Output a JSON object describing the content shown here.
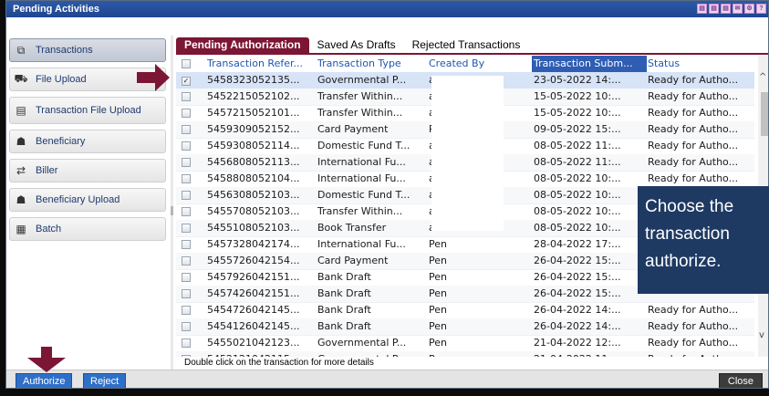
{
  "window": {
    "title": "Pending Activities"
  },
  "sidebar": {
    "items": [
      {
        "label": "Transactions",
        "icon": "transactions-icon",
        "glyph": "⧉"
      },
      {
        "label": "File Upload",
        "icon": "truck-icon",
        "glyph": "⛟"
      },
      {
        "label": "Transaction File Upload",
        "icon": "file-icon",
        "glyph": "▤"
      },
      {
        "label": "Beneficiary",
        "icon": "person-icon",
        "glyph": "☗"
      },
      {
        "label": "Biller",
        "icon": "handshake-icon",
        "glyph": "⇄"
      },
      {
        "label": "Beneficiary Upload",
        "icon": "person-upload-icon",
        "glyph": "☗"
      },
      {
        "label": "Batch",
        "icon": "batch-icon",
        "glyph": "▦"
      }
    ]
  },
  "tabs": [
    "Pending Authorization",
    "Saved As Drafts",
    "Rejected Transactions"
  ],
  "table": {
    "headers": [
      "Transaction Refer...",
      "Transaction Type",
      "Created By",
      "Transaction Subm...",
      "Status"
    ],
    "rows": [
      {
        "ref": "5458323052135...",
        "type": "Governmental P...",
        "by": "ahm",
        "date": "23-05-2022 14:...",
        "status": "Ready for Autho...",
        "checked": true
      },
      {
        "ref": "5452215052102...",
        "type": "Transfer Within...",
        "by": "ahm",
        "date": "15-05-2022 10:...",
        "status": "Ready for Autho...",
        "checked": false
      },
      {
        "ref": "5457215052101...",
        "type": "Transfer Within...",
        "by": "ahm",
        "date": "15-05-2022 10:...",
        "status": "Ready for Autho...",
        "checked": false
      },
      {
        "ref": "5459309052152...",
        "type": "Card Payment",
        "by": "Pen",
        "date": "09-05-2022 15:...",
        "status": "Ready for Autho...",
        "checked": false
      },
      {
        "ref": "5459308052114...",
        "type": "Domestic Fund T...",
        "by": "ahm",
        "date": "08-05-2022 11:...",
        "status": "Ready for Autho...",
        "checked": false
      },
      {
        "ref": "5456808052113...",
        "type": "International Fu...",
        "by": "ahm",
        "date": "08-05-2022 11:...",
        "status": "Ready for Autho...",
        "checked": false
      },
      {
        "ref": "5458808052104...",
        "type": "International Fu...",
        "by": "ahm",
        "date": "08-05-2022 10:...",
        "status": "Ready for Autho...",
        "checked": false
      },
      {
        "ref": "5456308052103...",
        "type": "Domestic Fund T...",
        "by": "ahm",
        "date": "08-05-2022 10:...",
        "status": "",
        "checked": false
      },
      {
        "ref": "5455708052103...",
        "type": "Transfer Within...",
        "by": "ahm",
        "date": "08-05-2022 10:...",
        "status": "",
        "checked": false
      },
      {
        "ref": "5455108052103...",
        "type": "Book Transfer",
        "by": "ahm",
        "date": "08-05-2022 10:...",
        "status": "",
        "checked": false
      },
      {
        "ref": "5457328042174...",
        "type": "International Fu...",
        "by": "Pen",
        "date": "28-04-2022 17:...",
        "status": "",
        "checked": false
      },
      {
        "ref": "5455726042154...",
        "type": "Card Payment",
        "by": "Pen",
        "date": "26-04-2022 15:...",
        "status": "",
        "checked": false
      },
      {
        "ref": "5457926042151...",
        "type": "Bank Draft",
        "by": "Pen",
        "date": "26-04-2022 15:...",
        "status": "",
        "checked": false
      },
      {
        "ref": "5457426042151...",
        "type": "Bank Draft",
        "by": "Pen",
        "date": "26-04-2022 15:...",
        "status": "",
        "checked": false
      },
      {
        "ref": "5454726042145...",
        "type": "Bank Draft",
        "by": "Pen",
        "date": "26-04-2022 14:...",
        "status": "Ready for Autho...",
        "checked": false
      },
      {
        "ref": "5454126042145...",
        "type": "Bank Draft",
        "by": "Pen",
        "date": "26-04-2022 14:...",
        "status": "Ready for Autho...",
        "checked": false
      },
      {
        "ref": "5455021042123...",
        "type": "Governmental P...",
        "by": "Pen",
        "date": "21-04-2022 12:...",
        "status": "Ready for Autho...",
        "checked": false
      },
      {
        "ref": "5452121042115...",
        "type": "Governmental P...",
        "by": "Pen",
        "date": "21-04-2022 11:...",
        "status": "Ready for Autho...",
        "checked": false
      }
    ]
  },
  "hint": "Double click on the transaction for more details",
  "buttons": {
    "authorize": "Authorize",
    "reject": "Reject",
    "close": "Close"
  },
  "callout": {
    "text": "Choose the transaction authorize."
  },
  "colors": {
    "accent": "#7b1634",
    "header_blue": "#2e5db3",
    "callout_bg": "#1e3a63",
    "arrow": "#7b1634"
  }
}
